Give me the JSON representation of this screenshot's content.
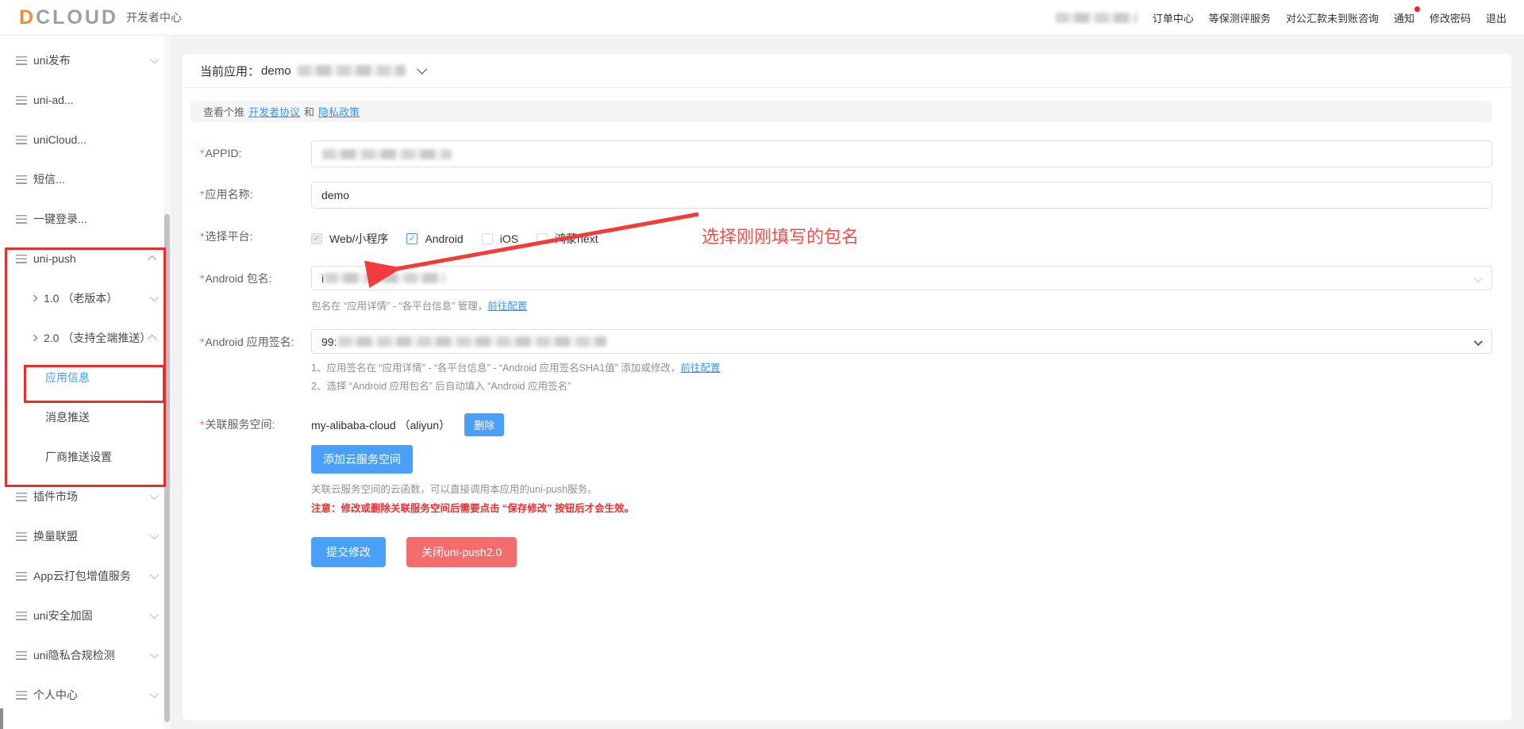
{
  "colors": {
    "accent": "#409eff",
    "danger": "#f56c6c",
    "annotation_red": "#ee2b2b",
    "link_blue": "#3d93f5"
  },
  "header": {
    "logo": "DCLOUD",
    "product_name": "开发者中心",
    "nav": {
      "order_center": "订单中心",
      "dengbao_service": "等保测评服务",
      "remittance_consult": "对公汇款未到账咨询",
      "notice": "通知",
      "change_password": "修改密码",
      "logout": "退出"
    }
  },
  "icons": {
    "sidebar_item": "list-icon",
    "expand_state_open": "chevron-up-icon",
    "expand_state_closed": "chevron-down-icon",
    "sub_prefix": "arrow-right-icon",
    "notice_badge": "red-dot"
  },
  "sidebar": {
    "items": [
      {
        "label": "uni发布",
        "chevron": "down"
      },
      {
        "label": "uni-ad..."
      },
      {
        "label": "uniCloud..."
      },
      {
        "label": "短信..."
      },
      {
        "label": "一键登录..."
      },
      {
        "label": "uni-push",
        "chevron": "up"
      },
      {
        "label": "1.0 （老版本）",
        "chevron": "down",
        "level": 2
      },
      {
        "label": "2.0 （支持全端推送）",
        "chevron": "up",
        "level": 2
      },
      {
        "label": "应用信息",
        "level": 3,
        "active": true
      },
      {
        "label": "消息推送",
        "level": 3
      },
      {
        "label": "厂商推送设置",
        "level": 3
      },
      {
        "label": "插件市场",
        "chevron": "down"
      },
      {
        "label": "换量联盟",
        "chevron": "down"
      },
      {
        "label": "App云打包增值服务",
        "chevron": "down"
      },
      {
        "label": "uni安全加固",
        "chevron": "down"
      },
      {
        "label": "uni隐私合规检测",
        "chevron": "down"
      },
      {
        "label": "个人中心",
        "chevron": "down"
      }
    ]
  },
  "main": {
    "current_app_label": "当前应用：",
    "current_app_name": "demo",
    "agreement": {
      "prefix": "查看个推",
      "developer_agreement": "开发者协议",
      "conjunction": "和",
      "privacy_policy": "隐私政策"
    },
    "form": {
      "required_marker": "*",
      "appid": {
        "label": "APPID:"
      },
      "app_name": {
        "label": "应用名称:",
        "value": "demo"
      },
      "platforms": {
        "label": "选择平台:",
        "options": [
          {
            "label": "Web/小程序",
            "checked": true,
            "disabled": true
          },
          {
            "label": "Android",
            "checked": true,
            "disabled": false
          },
          {
            "label": "iOS",
            "checked": false,
            "disabled": false
          },
          {
            "label": "鸿蒙next",
            "checked": false,
            "disabled": false
          }
        ],
        "check_glyph": "✓"
      },
      "android_package": {
        "label": "Android 包名:",
        "value_prefix": "i",
        "helper": "包名在 “应用详情” - “各平台信息” 管理，",
        "helper_link": "前往配置"
      },
      "android_signature": {
        "label": "Android 应用签名:",
        "value_prefix": "99:",
        "helper1": "1、应用签名在 “应用详情” - “各平台信息” - “Android 应用签名SHA1值” 添加或修改，",
        "helper1_link": "前往配置",
        "helper2": "2、选择 “Android 应用包名” 后自动填入 “Android 应用签名”"
      },
      "service_space": {
        "label": "关联服务空间:",
        "value": "my-alibaba-cloud （aliyun）",
        "delete_button": "删除",
        "add_button": "添加云服务空间",
        "helper": "关联云服务空间的云函数，可以直接调用本应用的uni-push服务。",
        "warning": "注意：修改或删除关联服务空间后需要点击 “保存修改” 按钮后才会生效。"
      },
      "buttons": {
        "submit": "提交修改",
        "close": "关闭uni-push2.0"
      }
    }
  },
  "annotation": {
    "text": "选择刚刚填写的包名"
  }
}
